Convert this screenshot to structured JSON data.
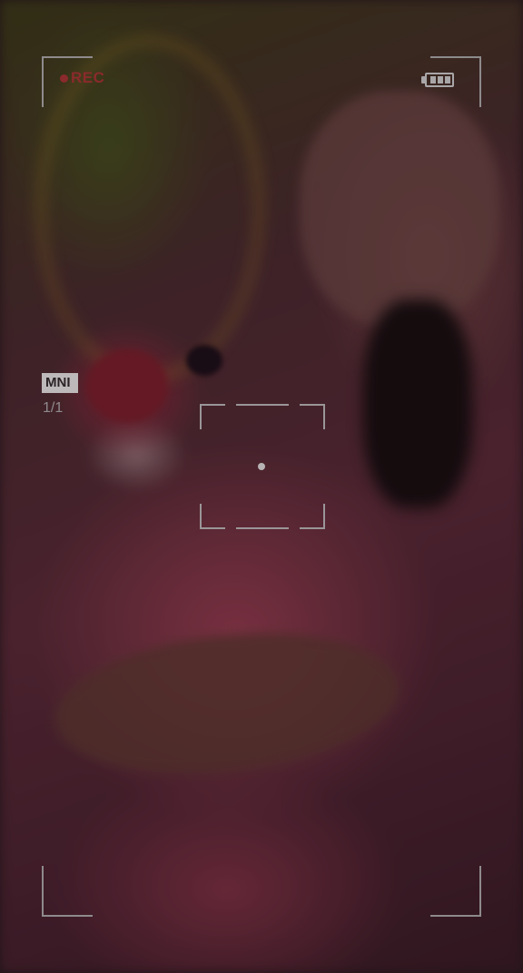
{
  "camera": {
    "rec_label": "REC",
    "rec_color": "#8a2a2c",
    "battery_icon": "battery-icon",
    "battery_bars": 3,
    "mode_label": "MNI",
    "counter": "1/1",
    "frame_color": "#8e8a8c"
  }
}
